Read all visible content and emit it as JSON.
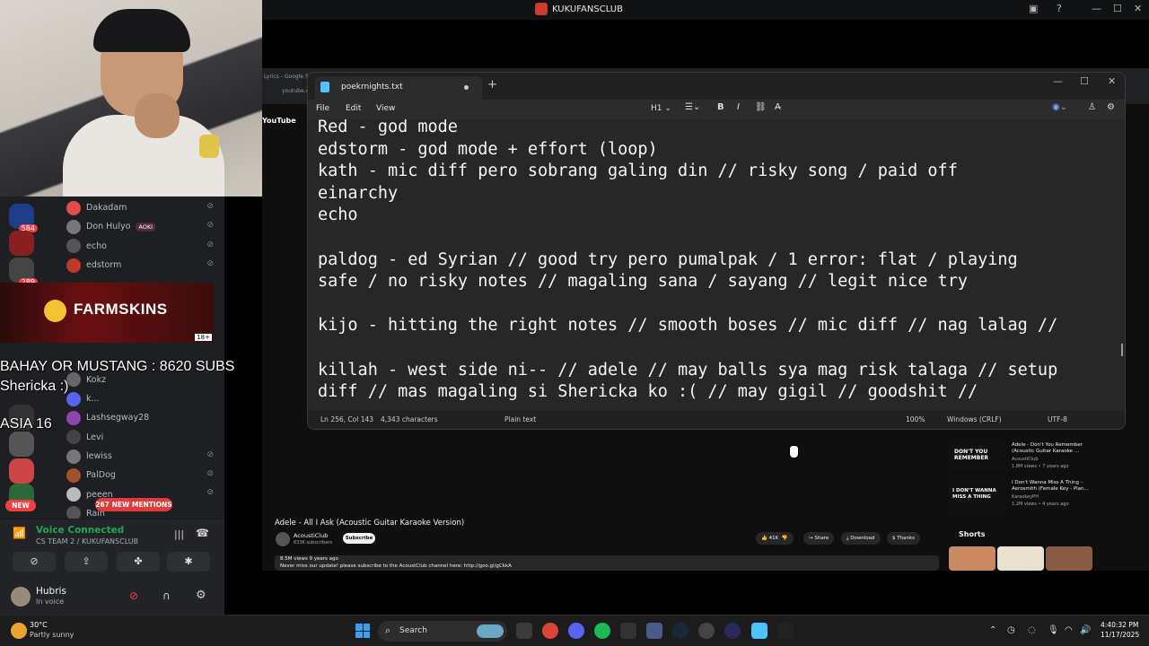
{
  "window": {
    "title": "KUKUFANSCLUB",
    "minimize": "—",
    "maximize": "☐",
    "close": "✕"
  },
  "discord": {
    "servers": [
      {
        "icon": "tgl-icon",
        "count": "584"
      },
      {
        "icon": "tgl-icon",
        "count": ""
      },
      {
        "icon": "server-icon",
        "count": "289"
      }
    ],
    "members": [
      {
        "name": "Dakadam",
        "tag": ""
      },
      {
        "name": "Don Hulyo",
        "tag": "AOKI"
      },
      {
        "name": "echo",
        "tag": ""
      },
      {
        "name": "edstorm",
        "tag": ""
      },
      {
        "name": "",
        "tag": ""
      },
      {
        "name": "",
        "tag": ""
      },
      {
        "name": "",
        "tag": ""
      },
      {
        "name": "",
        "tag": ""
      },
      {
        "name": "",
        "tag": ""
      },
      {
        "name": "Kokz",
        "tag": ""
      },
      {
        "name": "k...",
        "tag": ""
      },
      {
        "name": "Lashsegway28",
        "tag": ""
      },
      {
        "name": "Levi",
        "tag": ""
      },
      {
        "name": "lewiss",
        "tag": ""
      },
      {
        "name": "PalDog",
        "tag": ""
      },
      {
        "name": "peeen",
        "tag": ""
      },
      {
        "name": "Rain",
        "tag": ""
      }
    ],
    "new_mentions": "267 NEW MENTIONS",
    "new_label": "NEW",
    "voice": {
      "status": "Voice Connected",
      "channel": "CS TEAM 2 / KUKUFANSCLUB"
    },
    "user": {
      "name": "Hubris",
      "status": "In voice"
    }
  },
  "overlay": {
    "farmskins": "FARMSKINS",
    "farmskins_age": "18+",
    "subs_goal": "BAHAY OR MUSTANG : 8620 SUBS",
    "sub_name": "Shericka :)",
    "team_line": "ASIA 16"
  },
  "browser": {
    "tab_text": "Lyrics - Google Search",
    "address_text": "youtube.com",
    "yt_logo": "YouTube",
    "video_title": "Adele - All I Ask (Acoustic Guitar Karaoke Version)",
    "channel_name": "AcoustiClub",
    "channel_subs": "633K subscribers",
    "subscribe": "Subscribe",
    "likes": "41K",
    "share": "Share",
    "download": "Download",
    "thanks": "Thanks",
    "views_line": "8.5M views  9 years ago",
    "description": "Never miss our update! please subscribe to the AcoustClub channel here: http://goo.gl/gCkkA",
    "sidebar": [
      {
        "title": "Adele - Don't You Remember (Acoustic Guitar Karaoke ...",
        "channel": "AcoustiClub",
        "meta": "1.8M views • 7 years ago",
        "thumb_text": "DON'T YOU REMEMBER"
      },
      {
        "title": "I Don't Wanna Miss A Thing - Aerosmith (Female Key - Pian...",
        "channel": "KaraokeyPH",
        "meta": "1.2M views • 4 years ago",
        "thumb_text": "I DON'T WANNA MISS A THING"
      }
    ],
    "shorts_label": "Shorts"
  },
  "notepad": {
    "tab_title": "poekrnights.txt",
    "menu": [
      "File",
      "Edit",
      "View"
    ],
    "heading_tool": "H1",
    "lines": [
      "Red - god mode",
      "edstorm - god mode + effort (loop)",
      "kath - mic diff pero sobrang galing din // risky song / paid off",
      "einarchy",
      "echo",
      "",
      "paldog - ed Syrian // good try pero pumalpak / 1 error: flat / playing",
      "safe / no risky notes // magaling sana / sayang // legit nice try",
      "",
      "kijo - hitting the right notes // smooth boses // mic diff // nag lalag //",
      "",
      "killah - west side ni-- // adele // may balls sya mag risk talaga // setup",
      "diff // mas magaling si Shericka ko :( // may gigil // goodshit //"
    ],
    "status": {
      "position": "Ln 256, Col 143",
      "chars": "4,343 characters",
      "format": "Plain text",
      "zoom": "100%",
      "eol": "Windows (CRLF)",
      "encoding": "UTF-8"
    }
  },
  "taskbar": {
    "temp": "30°C",
    "weather": "Partly sunny",
    "search": "Search",
    "time": "4:40:32 PM",
    "date": "11/17/2025"
  }
}
